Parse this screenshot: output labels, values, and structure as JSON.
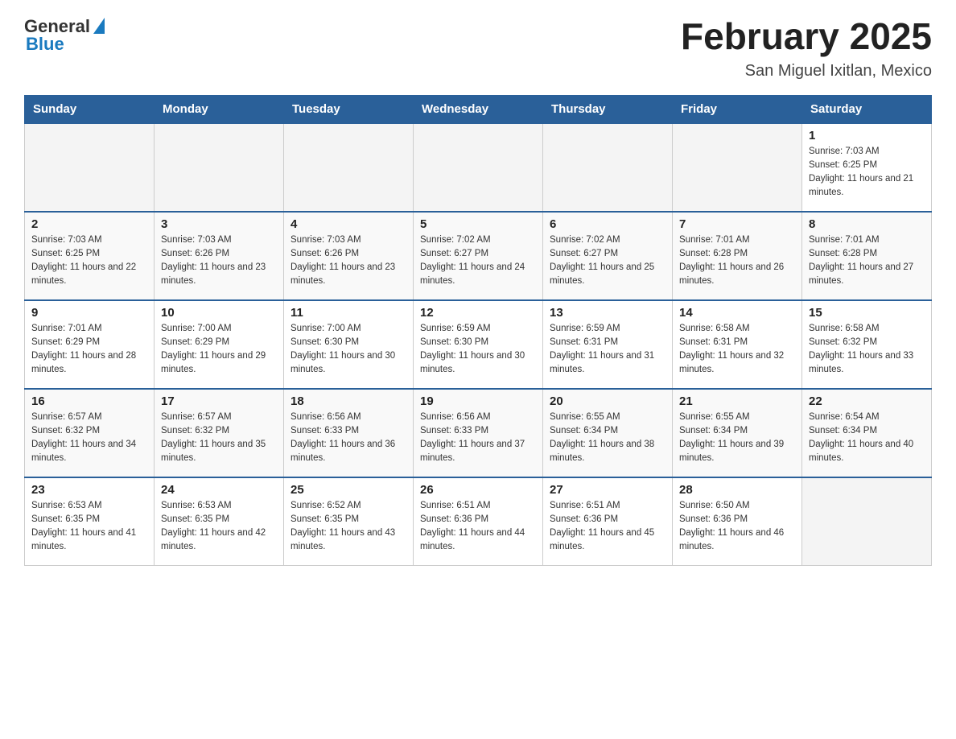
{
  "header": {
    "logo_general": "General",
    "logo_blue": "Blue",
    "month_title": "February 2025",
    "location": "San Miguel Ixitlan, Mexico"
  },
  "days_of_week": [
    "Sunday",
    "Monday",
    "Tuesday",
    "Wednesday",
    "Thursday",
    "Friday",
    "Saturday"
  ],
  "weeks": [
    [
      {
        "day": "",
        "info": ""
      },
      {
        "day": "",
        "info": ""
      },
      {
        "day": "",
        "info": ""
      },
      {
        "day": "",
        "info": ""
      },
      {
        "day": "",
        "info": ""
      },
      {
        "day": "",
        "info": ""
      },
      {
        "day": "1",
        "info": "Sunrise: 7:03 AM\nSunset: 6:25 PM\nDaylight: 11 hours and 21 minutes."
      }
    ],
    [
      {
        "day": "2",
        "info": "Sunrise: 7:03 AM\nSunset: 6:25 PM\nDaylight: 11 hours and 22 minutes."
      },
      {
        "day": "3",
        "info": "Sunrise: 7:03 AM\nSunset: 6:26 PM\nDaylight: 11 hours and 23 minutes."
      },
      {
        "day": "4",
        "info": "Sunrise: 7:03 AM\nSunset: 6:26 PM\nDaylight: 11 hours and 23 minutes."
      },
      {
        "day": "5",
        "info": "Sunrise: 7:02 AM\nSunset: 6:27 PM\nDaylight: 11 hours and 24 minutes."
      },
      {
        "day": "6",
        "info": "Sunrise: 7:02 AM\nSunset: 6:27 PM\nDaylight: 11 hours and 25 minutes."
      },
      {
        "day": "7",
        "info": "Sunrise: 7:01 AM\nSunset: 6:28 PM\nDaylight: 11 hours and 26 minutes."
      },
      {
        "day": "8",
        "info": "Sunrise: 7:01 AM\nSunset: 6:28 PM\nDaylight: 11 hours and 27 minutes."
      }
    ],
    [
      {
        "day": "9",
        "info": "Sunrise: 7:01 AM\nSunset: 6:29 PM\nDaylight: 11 hours and 28 minutes."
      },
      {
        "day": "10",
        "info": "Sunrise: 7:00 AM\nSunset: 6:29 PM\nDaylight: 11 hours and 29 minutes."
      },
      {
        "day": "11",
        "info": "Sunrise: 7:00 AM\nSunset: 6:30 PM\nDaylight: 11 hours and 30 minutes."
      },
      {
        "day": "12",
        "info": "Sunrise: 6:59 AM\nSunset: 6:30 PM\nDaylight: 11 hours and 30 minutes."
      },
      {
        "day": "13",
        "info": "Sunrise: 6:59 AM\nSunset: 6:31 PM\nDaylight: 11 hours and 31 minutes."
      },
      {
        "day": "14",
        "info": "Sunrise: 6:58 AM\nSunset: 6:31 PM\nDaylight: 11 hours and 32 minutes."
      },
      {
        "day": "15",
        "info": "Sunrise: 6:58 AM\nSunset: 6:32 PM\nDaylight: 11 hours and 33 minutes."
      }
    ],
    [
      {
        "day": "16",
        "info": "Sunrise: 6:57 AM\nSunset: 6:32 PM\nDaylight: 11 hours and 34 minutes."
      },
      {
        "day": "17",
        "info": "Sunrise: 6:57 AM\nSunset: 6:32 PM\nDaylight: 11 hours and 35 minutes."
      },
      {
        "day": "18",
        "info": "Sunrise: 6:56 AM\nSunset: 6:33 PM\nDaylight: 11 hours and 36 minutes."
      },
      {
        "day": "19",
        "info": "Sunrise: 6:56 AM\nSunset: 6:33 PM\nDaylight: 11 hours and 37 minutes."
      },
      {
        "day": "20",
        "info": "Sunrise: 6:55 AM\nSunset: 6:34 PM\nDaylight: 11 hours and 38 minutes."
      },
      {
        "day": "21",
        "info": "Sunrise: 6:55 AM\nSunset: 6:34 PM\nDaylight: 11 hours and 39 minutes."
      },
      {
        "day": "22",
        "info": "Sunrise: 6:54 AM\nSunset: 6:34 PM\nDaylight: 11 hours and 40 minutes."
      }
    ],
    [
      {
        "day": "23",
        "info": "Sunrise: 6:53 AM\nSunset: 6:35 PM\nDaylight: 11 hours and 41 minutes."
      },
      {
        "day": "24",
        "info": "Sunrise: 6:53 AM\nSunset: 6:35 PM\nDaylight: 11 hours and 42 minutes."
      },
      {
        "day": "25",
        "info": "Sunrise: 6:52 AM\nSunset: 6:35 PM\nDaylight: 11 hours and 43 minutes."
      },
      {
        "day": "26",
        "info": "Sunrise: 6:51 AM\nSunset: 6:36 PM\nDaylight: 11 hours and 44 minutes."
      },
      {
        "day": "27",
        "info": "Sunrise: 6:51 AM\nSunset: 6:36 PM\nDaylight: 11 hours and 45 minutes."
      },
      {
        "day": "28",
        "info": "Sunrise: 6:50 AM\nSunset: 6:36 PM\nDaylight: 11 hours and 46 minutes."
      },
      {
        "day": "",
        "info": ""
      }
    ]
  ]
}
